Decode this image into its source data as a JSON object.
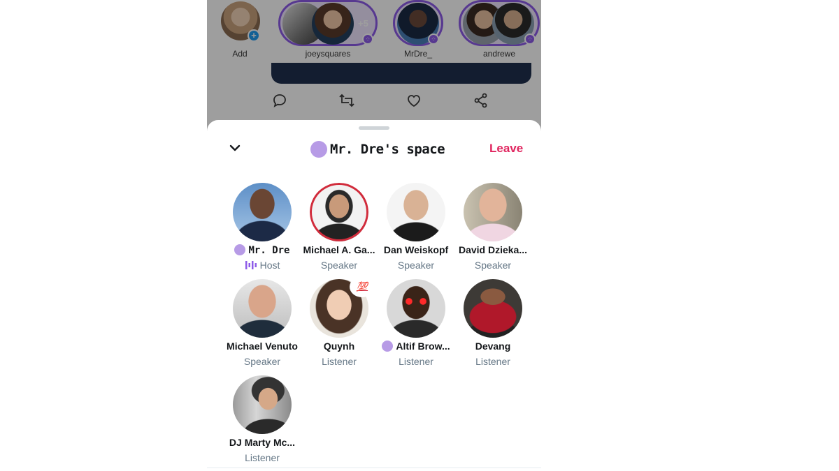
{
  "fleets": {
    "add_label": "Add",
    "items": [
      {
        "label": "joeysquares",
        "extra": "+5"
      },
      {
        "label": "MrDre_"
      },
      {
        "label": "andrewe"
      }
    ]
  },
  "sheet": {
    "title": "Mr. Dre's space",
    "leave_label": "Leave"
  },
  "participants": [
    {
      "name": "Mr. Dre",
      "role": "Host"
    },
    {
      "name": "Michael A. Ga...",
      "role": "Speaker"
    },
    {
      "name": "Dan Weiskopf",
      "role": "Speaker"
    },
    {
      "name": "David Dzieka...",
      "role": "Speaker"
    },
    {
      "name": "Michael Venuto",
      "role": "Speaker"
    },
    {
      "name": "Quynh",
      "role": "Listener",
      "reaction": "💯"
    },
    {
      "name": "Altif Brow...",
      "role": "Listener"
    },
    {
      "name": "Devang",
      "role": "Listener"
    },
    {
      "name": "DJ Marty Mc...",
      "role": "Listener"
    }
  ],
  "colors": {
    "accent_purple": "#8d5be8",
    "leave_red": "#e0245e",
    "secondary_text": "#657786"
  }
}
